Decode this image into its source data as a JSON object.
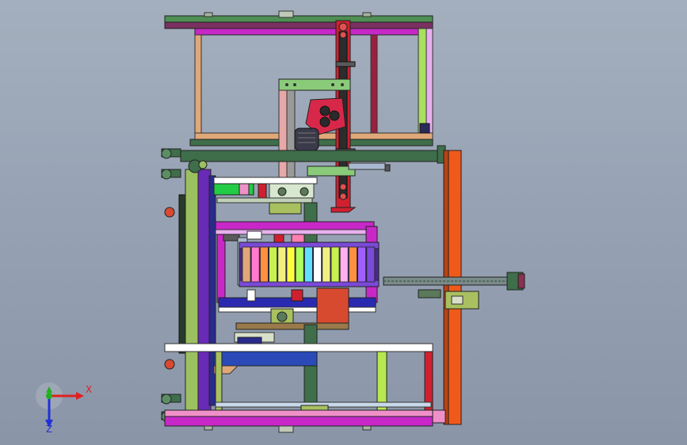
{
  "app": {
    "view": "cad-3d-viewport"
  },
  "triad": {
    "x_label": "X",
    "z_label": "Z",
    "x_color": "#e02020",
    "z_color": "#2030d8",
    "y_color": "#20b020"
  },
  "colors": {
    "background_top": "#a4afbe",
    "background_bottom": "#8a96a8",
    "frame_magenta": "#c828c8",
    "frame_dark_green": "#3f6e4a",
    "frame_orange": "#ef5a1a",
    "frame_tan": "#e0a878",
    "frame_purple": "#6a2ab8",
    "column_red": "#d02030",
    "pink": "#f090c8"
  },
  "icons": [
    "coordinate-triad-icon",
    "motor-icon",
    "gearbox-icon",
    "roller-icon"
  ]
}
